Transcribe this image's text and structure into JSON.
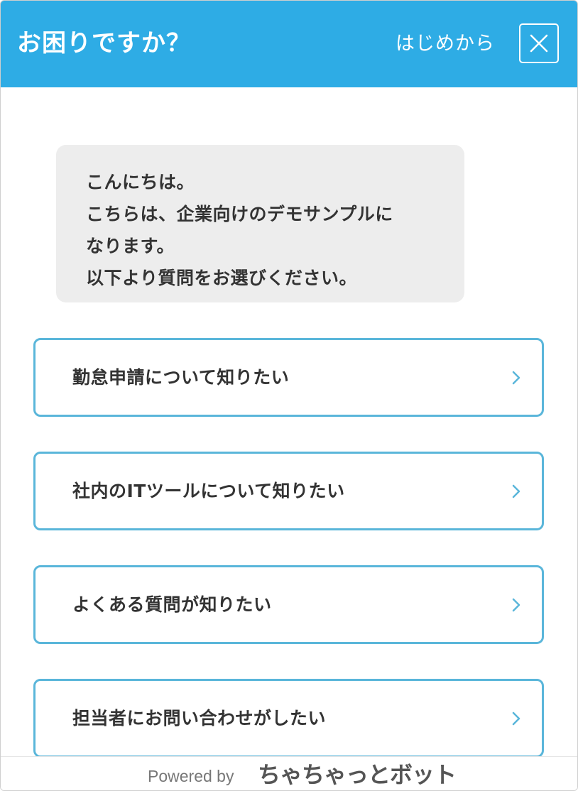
{
  "header": {
    "title": "お困りですか？",
    "restart_label": "はじめから",
    "close_icon": "close-icon",
    "background": "#2eace5"
  },
  "message": {
    "lines": [
      "こんにちは。",
      "こちらは、企業向けのデモサンプルに",
      "なります。",
      "以下より質問をお選びください。"
    ]
  },
  "options": [
    {
      "label": "勤怠申請について知りたい",
      "icon": "chevron-right-icon"
    },
    {
      "label": "社内のITツールについて知りたい",
      "icon": "chevron-right-icon"
    },
    {
      "label": "よくある質問が知りたい",
      "icon": "chevron-right-icon"
    },
    {
      "label": "担当者にお問い合わせがしたい",
      "icon": "chevron-right-icon"
    }
  ],
  "footer": {
    "powered_by": "Powered by",
    "brand": "ちゃちゃっとボット"
  },
  "colors": {
    "accent": "#2eace5",
    "option_border": "#5ab6da",
    "bubble_bg": "#ededed",
    "text": "#333333"
  }
}
